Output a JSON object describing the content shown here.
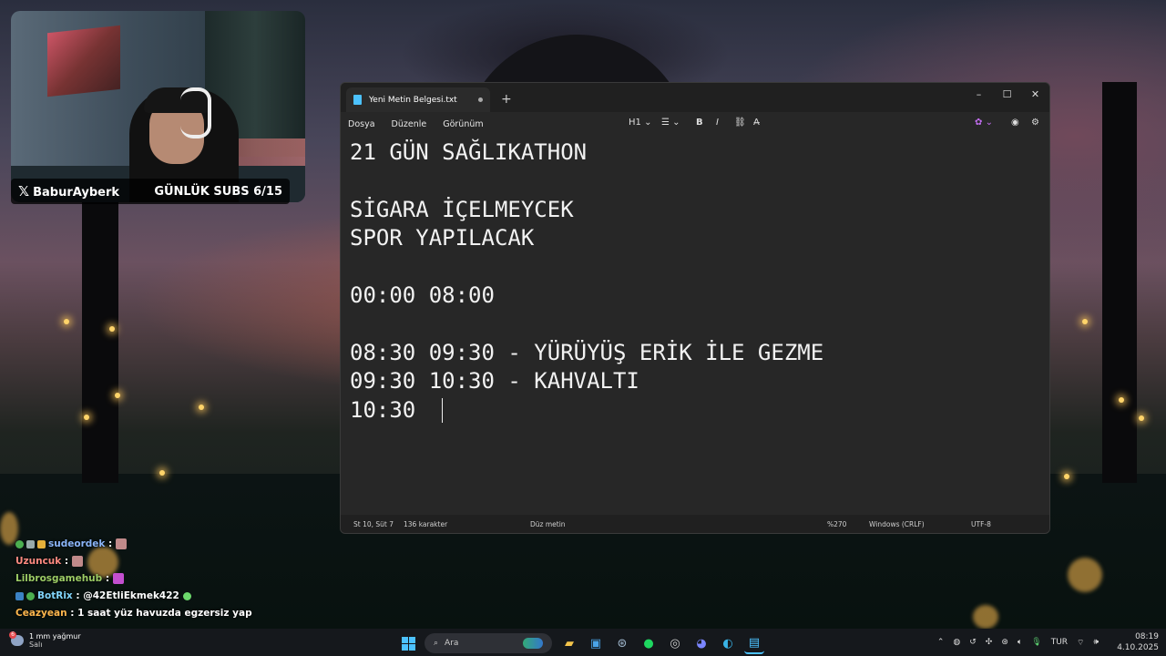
{
  "webcam": {
    "handle": "BaburAyberk",
    "subs_label": "GÜNLÜK SUBS 6/15"
  },
  "notepad": {
    "tab_title": "Yeni Metin Belgesi.txt",
    "menu": [
      "Dosya",
      "Düzenle",
      "Görünüm"
    ],
    "heading_select": "H1",
    "window_controls": [
      "–",
      "☐",
      "✕"
    ],
    "lines": [
      "21 GÜN SAĞLIKATHON",
      "",
      "SİGARA İÇELMEYCEK",
      "SPOR YAPILACAK",
      "",
      "00:00 08:00",
      "",
      "08:30 09:30 - YÜRÜYÜŞ ERİK İLE GEZME",
      "09:30 10:30 - KAHVALTI",
      "10:30 "
    ],
    "status": {
      "position": "St 10, Süt 7",
      "char_count": "136 karakter",
      "format": "Düz metin",
      "zoom": "%270",
      "line_endings": "Windows (CRLF)",
      "encoding": "UTF-8"
    }
  },
  "chat": [
    {
      "user": "sudeordek",
      "message": ""
    },
    {
      "user": "Uzuncuk",
      "message": ""
    },
    {
      "user": "Lilbrosgamehub",
      "message": ""
    },
    {
      "user": "BotRix",
      "message": "@42EtliEkmek422"
    },
    {
      "user": "Ceazyean",
      "message": "1 saat yüz havuzda egzersiz yap"
    }
  ],
  "taskbar": {
    "weather_temp": "1 mm yağmur",
    "weather_day": "Salı",
    "weather_badge": "6",
    "search_placeholder": "Ara",
    "language": "TUR",
    "time": "08:19",
    "date": "4.10.2025"
  },
  "colors": {
    "accent": "#4cc2ff",
    "editor_bg": "#272727"
  }
}
